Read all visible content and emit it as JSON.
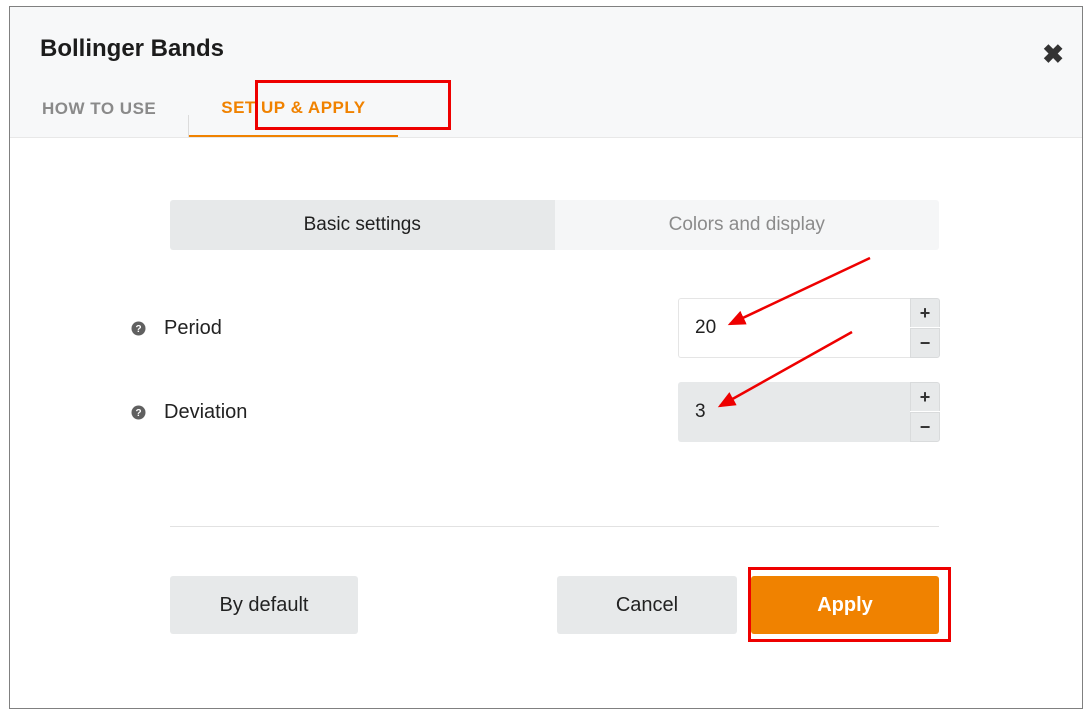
{
  "dialog": {
    "title": "Bollinger Bands"
  },
  "tabs": {
    "how_to_use": "HOW TO USE",
    "set_up_apply": "SET UP & APPLY"
  },
  "segmented": {
    "basic": "Basic settings",
    "colors": "Colors and display"
  },
  "fields": {
    "period": {
      "label": "Period",
      "value": "20"
    },
    "deviation": {
      "label": "Deviation",
      "value": "3"
    }
  },
  "footer": {
    "default": "By default",
    "cancel": "Cancel",
    "apply": "Apply"
  }
}
